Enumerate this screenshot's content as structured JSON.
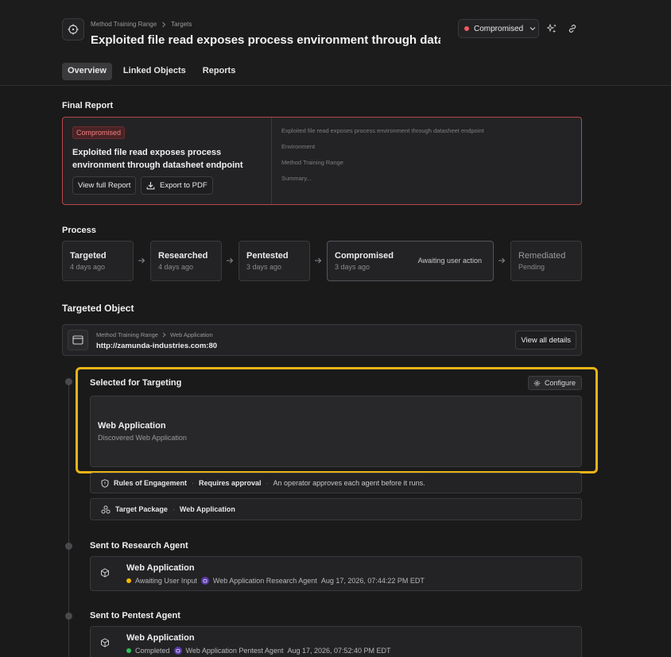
{
  "header": {
    "breadcrumb": [
      "Method Training Range",
      "Targets"
    ],
    "title": "Exploited file read exposes process environment through datasheet e...",
    "status": {
      "label": "Compromised",
      "color": "#f25a5a"
    }
  },
  "tabs": [
    {
      "label": "Overview",
      "active": true
    },
    {
      "label": "Linked Objects",
      "active": false
    },
    {
      "label": "Reports",
      "active": false
    }
  ],
  "final_report": {
    "section_title": "Final Report",
    "badge": "Compromised",
    "headline": "Exploited file read exposes process environment through datasheet endpoint",
    "view_button": "View full Report",
    "export_button": "Export to PDF",
    "preview_lines": [
      "Exploited file read exposes process environment through datasheet endpoint",
      "Environment",
      "Method Training Range",
      "Summary..."
    ]
  },
  "process": {
    "section_title": "Process",
    "steps": [
      {
        "name": "Targeted",
        "time": "4 days ago"
      },
      {
        "name": "Researched",
        "time": "4 days ago"
      },
      {
        "name": "Pentested",
        "time": "3 days ago"
      },
      {
        "name": "Compromised",
        "time": "3 days ago",
        "note": "Awaiting user action"
      },
      {
        "name": "Remediated",
        "time": "Pending"
      }
    ]
  },
  "targeted_object": {
    "section_title": "Targeted Object",
    "breadcrumb": [
      "Method Training Range",
      "Web Application"
    ],
    "url": "http://zamunda-industries.com:80",
    "view_all_button": "View all details"
  },
  "timeline": {
    "selected": {
      "title": "Selected for Targeting",
      "configure_button": "Configure",
      "card_title": "Web Application",
      "card_subtitle": "Discovered Web Application"
    },
    "rules": {
      "label": "Rules of Engagement",
      "value": "Requires approval",
      "description": "An operator approves each agent before it runs."
    },
    "package": {
      "label": "Target Package",
      "value": "Web Application"
    },
    "research": {
      "title": "Sent to Research Agent",
      "card_title": "Web Application",
      "status": "Awaiting User Input",
      "status_color": "#f5b800",
      "agent": "Web Application Research Agent",
      "timestamp": "Aug 17, 2026, 07:44:22 PM EDT"
    },
    "pentest": {
      "title": "Sent to Pentest Agent",
      "card_title": "Web Application",
      "status": "Completed",
      "status_color": "#2fc15a",
      "agent": "Web Application Pentest Agent",
      "timestamp": "Aug 17, 2026, 07:52:40 PM EDT"
    }
  }
}
